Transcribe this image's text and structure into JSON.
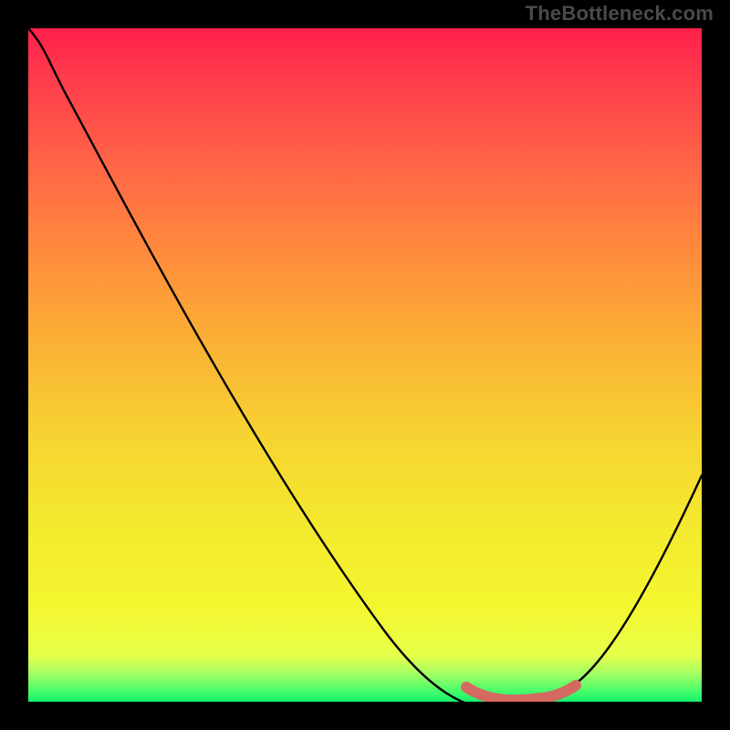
{
  "watermark": "TheBottleneck.com",
  "chart_data": {
    "type": "line",
    "title": "",
    "xlabel": "",
    "ylabel": "",
    "xlim": [
      0,
      100
    ],
    "ylim": [
      0,
      100
    ],
    "background": "red-yellow-green vertical gradient",
    "series": [
      {
        "name": "bottleneck-curve",
        "color": "#000000",
        "x": [
          0,
          3,
          10,
          20,
          30,
          40,
          50,
          55,
          60,
          65,
          70,
          75,
          80,
          85,
          90,
          95,
          100
        ],
        "values": [
          100,
          97,
          90,
          77,
          64,
          51,
          38,
          31,
          22,
          12,
          4,
          0,
          0,
          2,
          9,
          20,
          34
        ]
      },
      {
        "name": "optimal-range",
        "color": "#d4695f",
        "x": [
          70,
          72,
          75,
          78,
          80,
          82,
          84
        ],
        "values": [
          3,
          1,
          0,
          0,
          0,
          1,
          3
        ]
      }
    ],
    "optimal_range_x": [
      70,
      84
    ]
  }
}
